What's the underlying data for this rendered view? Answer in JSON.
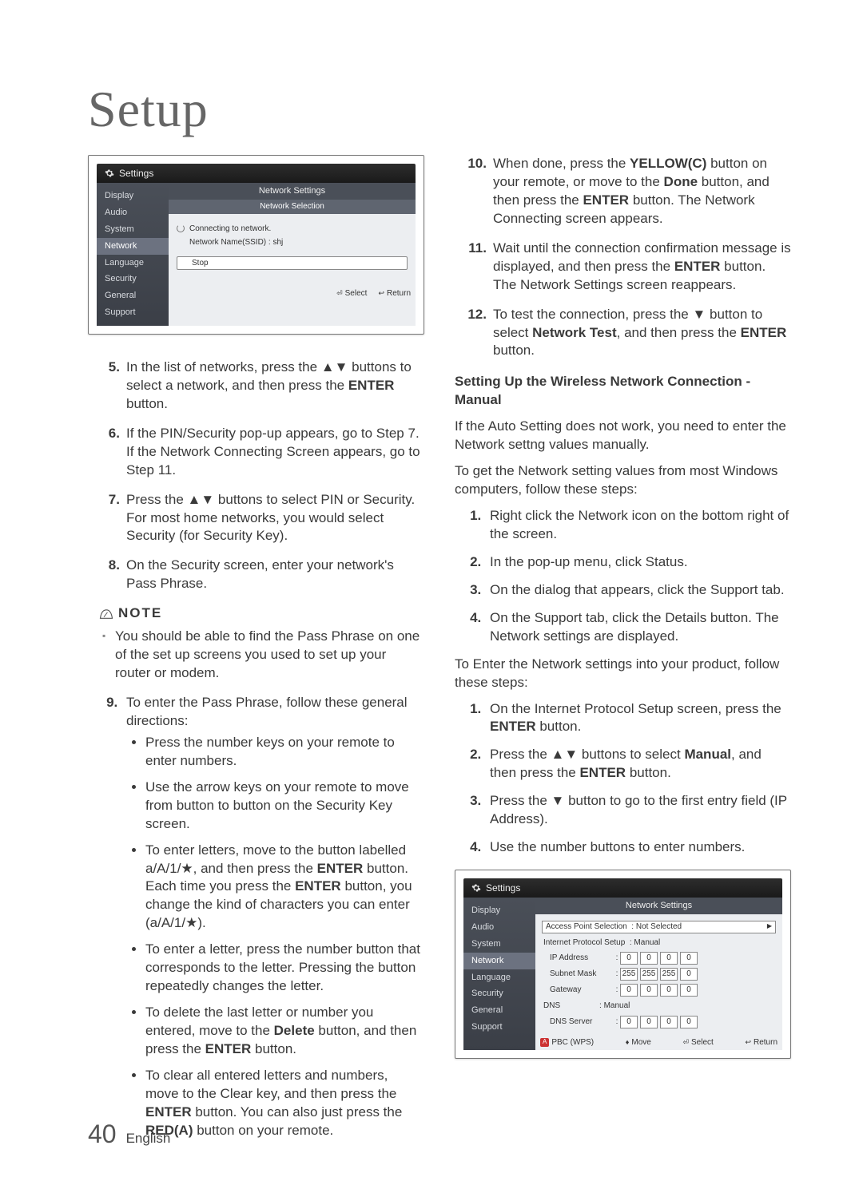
{
  "title": "Setup",
  "page_number": "40",
  "page_lang": "English",
  "screenshot1": {
    "topbar_label": "Settings",
    "sidebar": [
      "Display",
      "Audio",
      "System",
      "Network",
      "Language",
      "Security",
      "General",
      "Support"
    ],
    "panel_title": "Network Settings",
    "panel_selection": "Network Selection",
    "connecting": "Connecting to network.",
    "ssid": "Network Name(SSID) : shj",
    "stop": "Stop",
    "footer_select": "Select",
    "footer_return": "Return"
  },
  "left": {
    "s5": "In the list of networks, press the ▲▼ buttons to select a network, and then press the ENTER button.",
    "s6": "If the PIN/Security pop-up appears, go to Step 7. If the Network Connecting Screen appears, go to Step 11.",
    "s7a": "Press the ▲▼ buttons to select PIN or Security.",
    "s7b": "For most home networks, you would select Security (for Security Key).",
    "s8": "On the Security screen, enter your network's Pass Phrase.",
    "note_label": "NOTE",
    "note_text": "You should be able to find the Pass Phrase on one of the set up screens you used to set up your router or modem.",
    "s9": "To enter the Pass Phrase, follow these general directions:",
    "b1": "Press the number keys on your remote to enter numbers.",
    "b2": "Use the arrow keys on your remote to move from button to button on the Security Key screen.",
    "b3": "To enter letters, move to the button labelled a/A/1/★, and then press the ENTER button. Each time you press the ENTER button, you change the kind of characters you can enter (a/A/1/★).",
    "b4": "To enter a letter, press the number button that corresponds to the letter. Pressing the button repeatedly changes the letter.",
    "b5": "To delete the last letter or number you entered, move to the Delete button, and then press the ENTER button.",
    "b6": "To clear all entered letters and numbers, move to the Clear key, and then press the ENTER button. You can also just press the RED(A) button on your remote."
  },
  "right": {
    "s10": "When done, press the YELLOW(C) button on your remote, or move to the Done button, and then press the ENTER button. The Network Connecting screen appears.",
    "s11": "Wait until the connection confirmation message is displayed, and then press the ENTER button. The Network Settings screen reappears.",
    "s12": "To test the connection, press the ▼ button to select Network Test, and then press the ENTER button.",
    "subhead": "Setting Up the Wireless Network Connection - Manual",
    "p1": "If the Auto Setting does not work, you need to enter the Network settng values manually.",
    "p2": "To get the Network setting values from most Windows computers, follow these steps:",
    "r1": "Right click the Network icon on the bottom right of the screen.",
    "r2": "In the pop-up menu, click Status.",
    "r3": "On the dialog that appears, click the Support tab.",
    "r4": "On the Support tab, click the Details button. The Network settings are displayed.",
    "p3": "To Enter the Network settings into your product, follow these steps:",
    "m1": "On the Internet Protocol Setup screen, press the ENTER button.",
    "m2": "Press the ▲▼ buttons to select Manual, and then press the ENTER button.",
    "m3": "Press the ▼ button to go to the first entry field (IP Address).",
    "m4": "Use the number buttons to enter numbers."
  },
  "screenshot2": {
    "topbar_label": "Settings",
    "sidebar": [
      "Display",
      "Audio",
      "System",
      "Network",
      "Language",
      "Security",
      "General",
      "Support"
    ],
    "panel_title": "Network Settings",
    "ap_label": "Access Point Selection",
    "ap_value": "Not Selected",
    "ips_label": "Internet Protocol Setup",
    "ips_value": "Manual",
    "ip_label": "IP Address",
    "subnet_label": "Subnet Mask",
    "gateway_label": "Gateway",
    "dns_label": "DNS",
    "dns_value": "Manual",
    "dnsserver_label": "DNS Server",
    "ip_vals": [
      "0",
      "0",
      "0",
      "0"
    ],
    "subnet_vals": [
      "255",
      "255",
      "255",
      "0"
    ],
    "gateway_vals": [
      "0",
      "0",
      "0",
      "0"
    ],
    "dnsserver_vals": [
      "0",
      "0",
      "0",
      "0"
    ],
    "footer_pbc": "PBC (WPS)",
    "footer_move": "Move",
    "footer_select": "Select",
    "footer_return": "Return",
    "red_box": "A"
  }
}
